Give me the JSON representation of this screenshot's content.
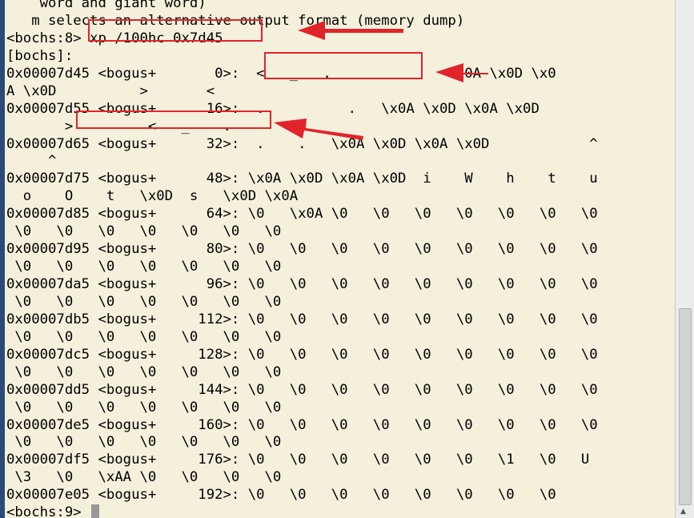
{
  "terminal": {
    "lines": [
      "    word and giant word)",
      "   m selects an alternative output format (memory dump)",
      "<bochs:8> xp /100hc 0x7d45",
      "[bochs]:",
      "0x00007d45 <bogus+       0>:  <   _   .              \\x0A \\x0D \\x0",
      "A \\x0D          >       <",
      "0x00007d55 <bogus+      16>:  .          .   \\x0A \\x0D \\x0A \\x0D",
      "       >         <   _    .",
      "0x00007d65 <bogus+      32>:  .    .   \\x0A \\x0D \\x0A \\x0D            ^",
      "     ^",
      "0x00007d75 <bogus+      48>: \\x0A \\x0D \\x0A \\x0D  i    W    h    t    u",
      "  o    O    t   \\x0D  s   \\x0D \\x0A",
      "0x00007d85 <bogus+      64>: \\0   \\x0A \\0   \\0   \\0   \\0   \\0   \\0   \\0",
      " \\0   \\0   \\0   \\0   \\0   \\0   \\0",
      "0x00007d95 <bogus+      80>: \\0   \\0   \\0   \\0   \\0   \\0   \\0   \\0   \\0",
      " \\0   \\0   \\0   \\0   \\0   \\0   \\0",
      "0x00007da5 <bogus+      96>: \\0   \\0   \\0   \\0   \\0   \\0   \\0   \\0   \\0",
      " \\0   \\0   \\0   \\0   \\0   \\0   \\0",
      "0x00007db5 <bogus+     112>: \\0   \\0   \\0   \\0   \\0   \\0   \\0   \\0   \\0",
      " \\0   \\0   \\0   \\0   \\0   \\0   \\0",
      "0x00007dc5 <bogus+     128>: \\0   \\0   \\0   \\0   \\0   \\0   \\0   \\0   \\0",
      " \\0   \\0   \\0   \\0   \\0   \\0   \\0",
      "0x00007dd5 <bogus+     144>: \\0   \\0   \\0   \\0   \\0   \\0   \\0   \\0   \\0",
      " \\0   \\0   \\0   \\0   \\0   \\0   \\0",
      "0x00007de5 <bogus+     160>: \\0   \\0   \\0   \\0   \\0   \\0   \\0   \\0   \\0",
      " \\0   \\0   \\0   \\0   \\0   \\0   \\0",
      "0x00007df5 <bogus+     176>: \\0   \\0   \\0   \\0   \\0   \\0   \\1   \\0   U",
      " \\3   \\0   \\xAA \\0   \\0   \\0   \\0",
      "0x00007e05 <bogus+     192>: \\0   \\0   \\0   \\0   \\0   \\0   \\0   \\0",
      "<bochs:9> "
    ]
  },
  "colors": {
    "terminal_bg": "#f5f0dc",
    "text": "#000000",
    "annotation_red": "#e0242a",
    "cursor": "#999999"
  },
  "icons": {
    "scroll_down": "scroll-down-arrow-icon"
  }
}
